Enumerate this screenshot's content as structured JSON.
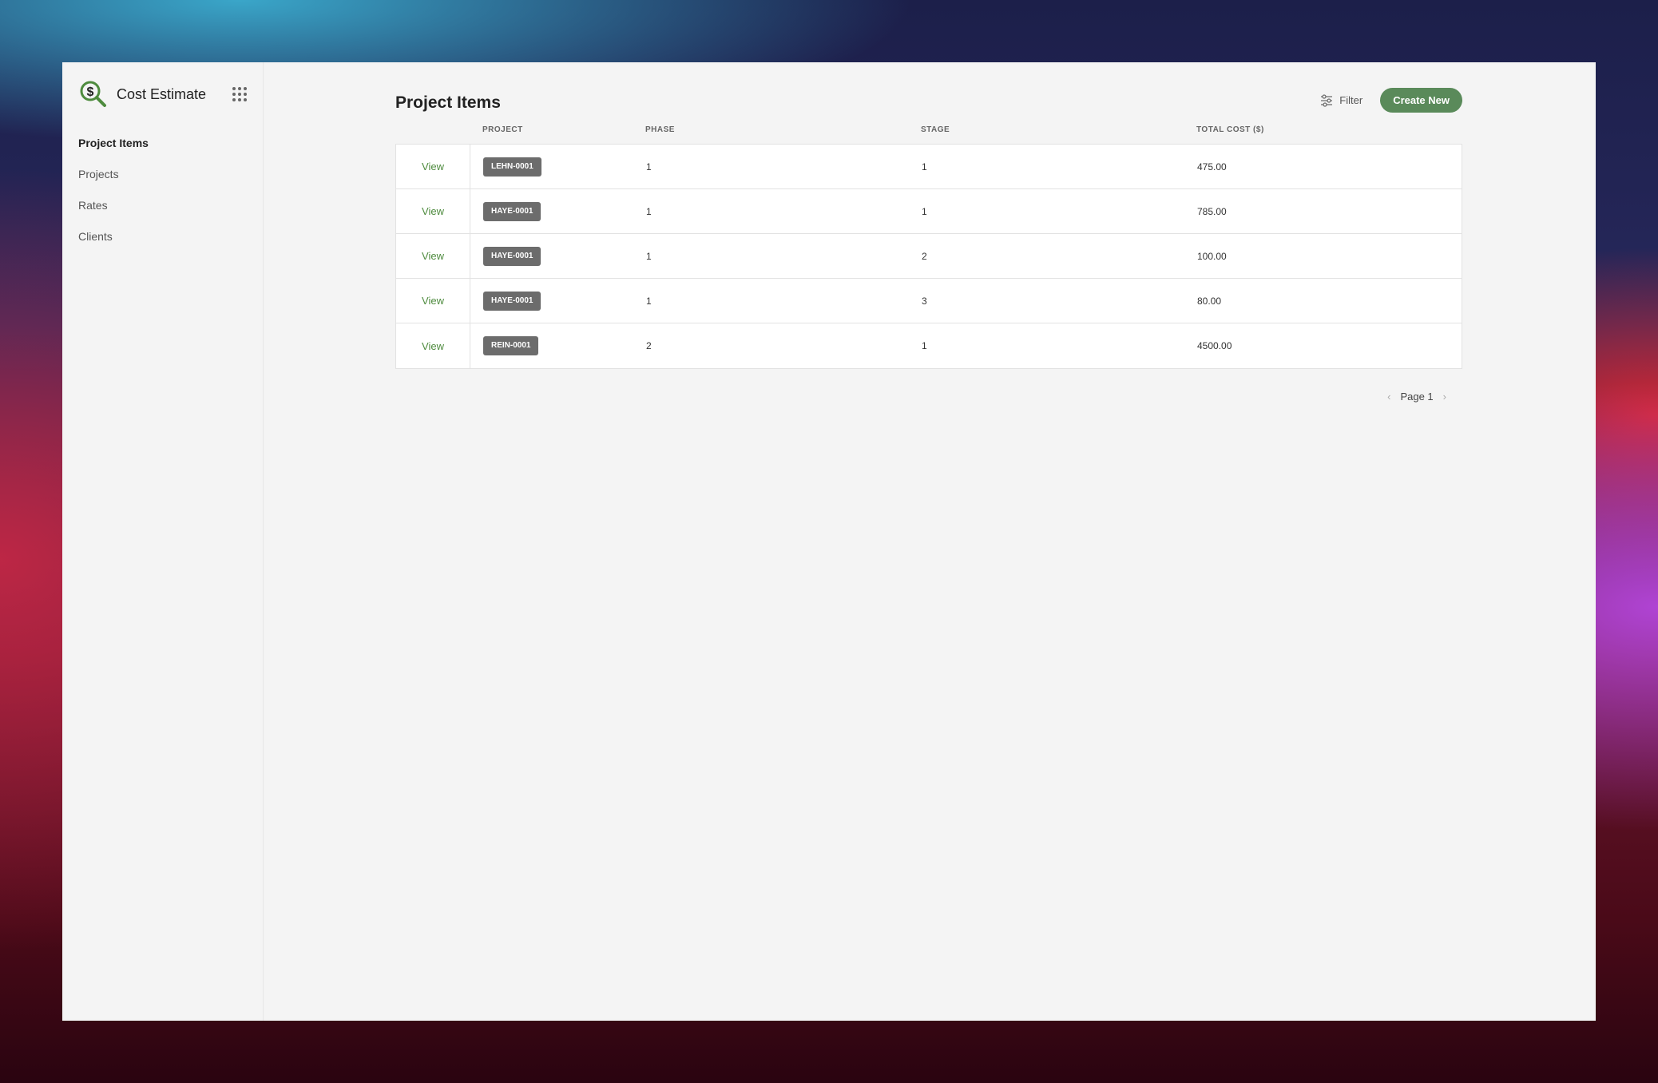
{
  "app": {
    "name": "Cost Estimate",
    "accent_color": "#5a8a5a"
  },
  "sidebar": {
    "items": [
      {
        "label": "Project Items",
        "active": true
      },
      {
        "label": "Projects",
        "active": false
      },
      {
        "label": "Rates",
        "active": false
      },
      {
        "label": "Clients",
        "active": false
      }
    ]
  },
  "page": {
    "title": "Project Items",
    "filter_label": "Filter",
    "create_label": "Create New"
  },
  "table": {
    "columns": [
      "PROJECT",
      "PHASE",
      "STAGE",
      "TOTAL COST ($)"
    ],
    "view_label": "View",
    "rows": [
      {
        "project": "LEHN-0001",
        "phase": "1",
        "stage": "1",
        "total_cost": "475.00"
      },
      {
        "project": "HAYE-0001",
        "phase": "1",
        "stage": "1",
        "total_cost": "785.00"
      },
      {
        "project": "HAYE-0001",
        "phase": "1",
        "stage": "2",
        "total_cost": "100.00"
      },
      {
        "project": "HAYE-0001",
        "phase": "1",
        "stage": "3",
        "total_cost": "80.00"
      },
      {
        "project": "REIN-0001",
        "phase": "2",
        "stage": "1",
        "total_cost": "4500.00"
      }
    ]
  },
  "pagination": {
    "label": "Page 1"
  }
}
